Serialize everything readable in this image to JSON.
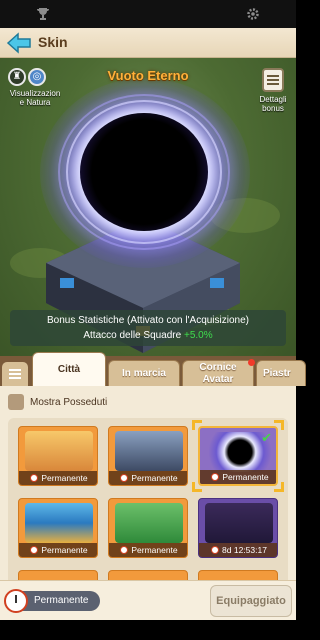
{
  "status_bar": {
    "left_icon": "trophy-icon",
    "right_icon": "settings-icon"
  },
  "header": {
    "title": "Skin",
    "back_icon": "arrow-left-icon"
  },
  "hero": {
    "skin_name": "Vuoto Eterno",
    "left_button": {
      "label": "Visualizzazion e Natura",
      "icons": [
        "castle-icon",
        "world-icon"
      ]
    },
    "right_button": {
      "label": "Dettagli bonus",
      "icon": "document-icon"
    },
    "bonus": {
      "line1": "Bonus Statistiche (Attivato con l'Acquisizione)",
      "line2_prefix": "Attacco delle Squadre ",
      "line2_value": "+5.0%"
    }
  },
  "tabs": [
    {
      "label": "Città",
      "active": true
    },
    {
      "label": "In marcia",
      "active": false
    },
    {
      "label": "Cornice Avatar",
      "active": false,
      "badge": true
    },
    {
      "label": "Piastr",
      "active": false
    }
  ],
  "filter": {
    "label": "Mostra Posseduti",
    "checked": false
  },
  "skins": [
    {
      "footer": "Permanente",
      "style": "orange",
      "selected": false
    },
    {
      "footer": "Permanente",
      "style": "orange",
      "selected": false
    },
    {
      "footer": "Permanente",
      "style": "dark",
      "selected": true,
      "equipped": true
    },
    {
      "footer": "Permanente",
      "style": "orange",
      "selected": false
    },
    {
      "footer": "Permanente",
      "style": "orange",
      "selected": false
    },
    {
      "footer": "8d 12:53:17",
      "style": "purple",
      "selected": false
    }
  ],
  "bottom": {
    "duration_label": "Permanente",
    "equip_button": "Equipaggiato"
  },
  "colors": {
    "accent_orange": "#f29a3c",
    "name_gold": "#ffb13a",
    "bonus_green": "#3fde4e"
  }
}
